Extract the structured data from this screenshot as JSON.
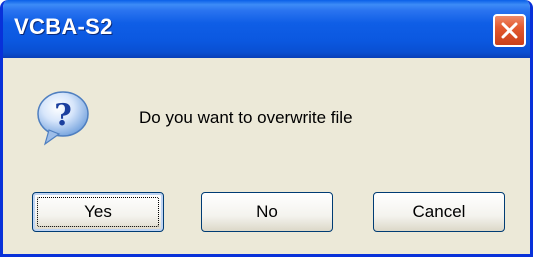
{
  "dialog": {
    "title": "VCBA-S2",
    "message": "Do you want to overwrite file",
    "icon": "question-icon",
    "close_icon": "close-icon"
  },
  "buttons": {
    "yes_label": "Yes",
    "no_label": "No",
    "cancel_label": "Cancel"
  },
  "colors": {
    "titlebar_blue": "#0a5fe8",
    "close_red": "#e35a30",
    "dialog_face": "#ece9d8"
  }
}
